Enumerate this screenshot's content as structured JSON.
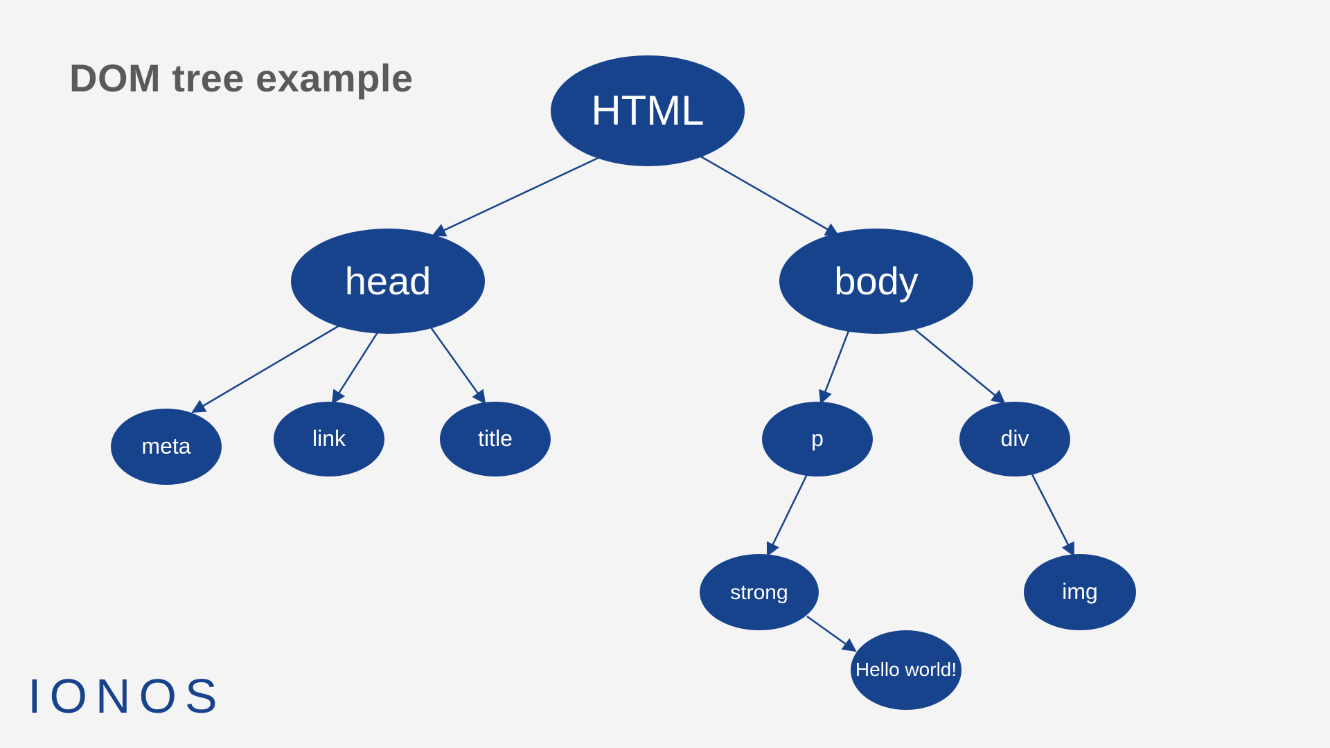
{
  "title": "DOM tree example",
  "brand": "IONOS",
  "colors": {
    "node_fill": "#17428c",
    "node_text": "#ffffff",
    "bg": "#f4f4f4",
    "title": "#5a5a5a"
  },
  "nodes": {
    "html": "HTML",
    "head": "head",
    "body": "body",
    "meta": "meta",
    "link": "link",
    "title": "title",
    "p": "p",
    "div": "div",
    "strong": "strong",
    "img": "img",
    "hello": "Hello world!"
  },
  "edges": [
    [
      "html",
      "head"
    ],
    [
      "html",
      "body"
    ],
    [
      "head",
      "meta"
    ],
    [
      "head",
      "link"
    ],
    [
      "head",
      "title"
    ],
    [
      "body",
      "p"
    ],
    [
      "body",
      "div"
    ],
    [
      "p",
      "strong"
    ],
    [
      "div",
      "img"
    ],
    [
      "strong",
      "hello"
    ]
  ]
}
